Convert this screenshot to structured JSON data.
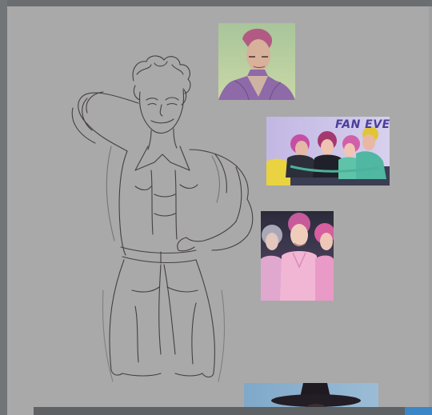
{
  "canvas": {
    "background": "#a9a9a9",
    "sketch_stroke": "#3b3438"
  },
  "references": [
    {
      "name": "reference-portrait-green",
      "caption": ""
    },
    {
      "name": "reference-group-fan-event",
      "caption": "FAN EVE"
    },
    {
      "name": "reference-group-pink-outfits",
      "caption": ""
    },
    {
      "name": "reference-witch-hat",
      "caption": ""
    }
  ],
  "icons": [
    "figure-sketch"
  ]
}
